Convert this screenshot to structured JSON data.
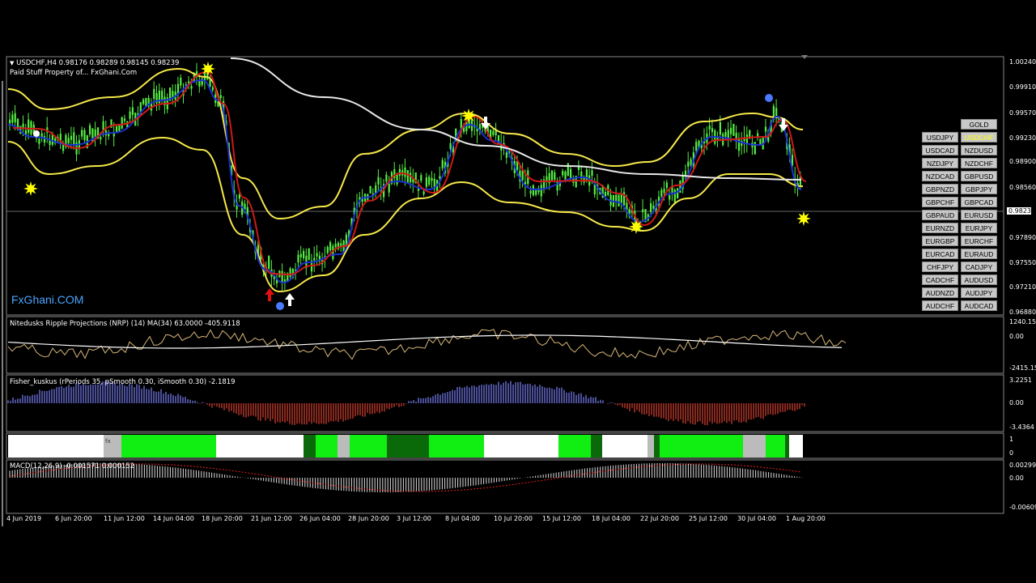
{
  "header": {
    "symbol_info": "USDCHF,H4  0.98176 0.98289 0.98145 0.98239",
    "subtitle": "Paid Stuff Property of... FxGhani.Com",
    "watermark": "FxGhani.COM"
  },
  "price_axis": {
    "labels": [
      "1.00240",
      "0.99910",
      "0.99570",
      "0.99230",
      "0.98900",
      "0.98560",
      "0.98239",
      "0.97890",
      "0.97550",
      "0.97210",
      "0.96880"
    ],
    "current_price": "0.98239"
  },
  "symbol_buttons": [
    {
      "label": "GOLD"
    },
    {
      "label": "USDJPY"
    },
    {
      "label": "USDCHF"
    },
    {
      "label": "USDCAD"
    },
    {
      "label": "NZDUSD"
    },
    {
      "label": "NZDJPY"
    },
    {
      "label": "NZDCHF"
    },
    {
      "label": "NZDCAD"
    },
    {
      "label": "GBPUSD"
    },
    {
      "label": "GBPNZD"
    },
    {
      "label": "GBPJPY"
    },
    {
      "label": "GBPCHF"
    },
    {
      "label": "GBPCAD"
    },
    {
      "label": "GBPAUD"
    },
    {
      "label": "EURUSD"
    },
    {
      "label": "EURNZD"
    },
    {
      "label": "EURJPY"
    },
    {
      "label": "EURGBP"
    },
    {
      "label": "EURCHF"
    },
    {
      "label": "EURCAD"
    },
    {
      "label": "EURAUD"
    },
    {
      "label": "CHFJPY"
    },
    {
      "label": "CADJPY"
    },
    {
      "label": "CADCHF"
    },
    {
      "label": "AUDUSD"
    },
    {
      "label": "AUDNZD"
    },
    {
      "label": "AUDJPY"
    },
    {
      "label": "AUDCHF"
    },
    {
      "label": "AUDCAD"
    }
  ],
  "active_symbol": "USDCHF",
  "indicators": {
    "nrp": {
      "title": "Nitedusks Ripple Projections (NRP) (14) MA(34) 63.0000 -405.9118",
      "axis": [
        "1240.15",
        "0.00",
        "-2415.15"
      ]
    },
    "fisher": {
      "title": "Fisher_kuskus  (rPeriods 35, pSmooth 0.30, iSmooth 0.30)  -2.1819",
      "axis": [
        "3.2251",
        "0.00",
        "-3.4364"
      ]
    },
    "strip": {
      "label": "fx",
      "axis": [
        "1",
        "0"
      ]
    },
    "macd": {
      "title": "MACD(12,26,9) -0.001571 0.000152",
      "axis": [
        "0.002999",
        "0.00",
        "-0.00609"
      ]
    }
  },
  "time_axis": [
    "4 Jun 2019",
    "6 Jun 20:00",
    "11 Jun 12:00",
    "14 Jun 04:00",
    "18 Jun 20:00",
    "21 Jun 12:00",
    "26 Jun 04:00",
    "28 Jun 20:00",
    "3 Jul 12:00",
    "8 Jul 04:00",
    "10 Jul 20:00",
    "15 Jul 12:00",
    "18 Jul 04:00",
    "22 Jul 20:00",
    "25 Jul 12:00",
    "30 Jul 04:00",
    "1 Aug 20:00"
  ],
  "colors": {
    "candle": "#55ee44",
    "band": "#f5e84a",
    "ma_red": "#d01818",
    "ma_blue": "#1a2fd0",
    "ma_white": "#e8e8e8",
    "fisher_up": "#6a70d8",
    "fisher_down": "#c0392b",
    "strip_green": "#11ee11",
    "strip_dark": "#0a6a0a",
    "strip_gray": "#bbbbbb",
    "axis_price_bg": "#ffffff"
  }
}
